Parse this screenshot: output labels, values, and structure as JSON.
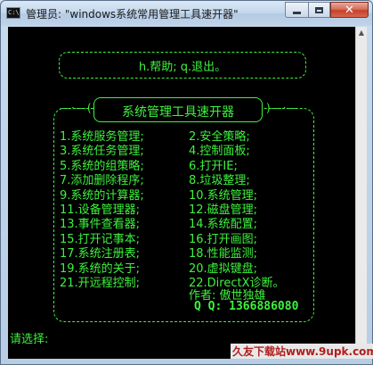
{
  "window": {
    "title": "管理员: \"windows系统常用管理工具速开器\"",
    "icon_label": "C:\\"
  },
  "console": {
    "header": "h.帮助; q.退出。",
    "section_title": "系统管理工具速开器",
    "dash_left": "—·—(",
    "dash_right": ")—·—",
    "menu": [
      {
        "left": "1.系统服务管理;",
        "right": "2.安全策略;"
      },
      {
        "left": "3.系统任务管理;",
        "right": "4.控制面板;"
      },
      {
        "left": "5.系统的组策略;",
        "right": "6.打开IE;"
      },
      {
        "left": "7.添加删除程序;",
        "right": "8.垃圾整理;"
      },
      {
        "left": "9.系统的计算器;",
        "right": "10.系统管理;"
      },
      {
        "left": "11.设备管理器;",
        "right": "12.磁盘管理;"
      },
      {
        "left": "13.事件查看器;",
        "right": "14.系统配置;"
      },
      {
        "left": "15.打开记事本;",
        "right": "16.打开画图;"
      },
      {
        "left": "17.系统注册表;",
        "right": "18.性能监测;"
      },
      {
        "left": "19.系统的关于;",
        "right": "20.虚拟键盘;"
      },
      {
        "left": "21.开远程控制;",
        "right": "22.DirectX诊断。"
      }
    ],
    "author": "作者: 傲世独雄",
    "qq": "Q Q: 1366886080",
    "prompt": "请选择:"
  },
  "watermark": "久友下载站www.9upk.com",
  "colors": {
    "console_text": "#3ef23e",
    "console_bg": "#000000",
    "close_button": "#c4412a"
  }
}
